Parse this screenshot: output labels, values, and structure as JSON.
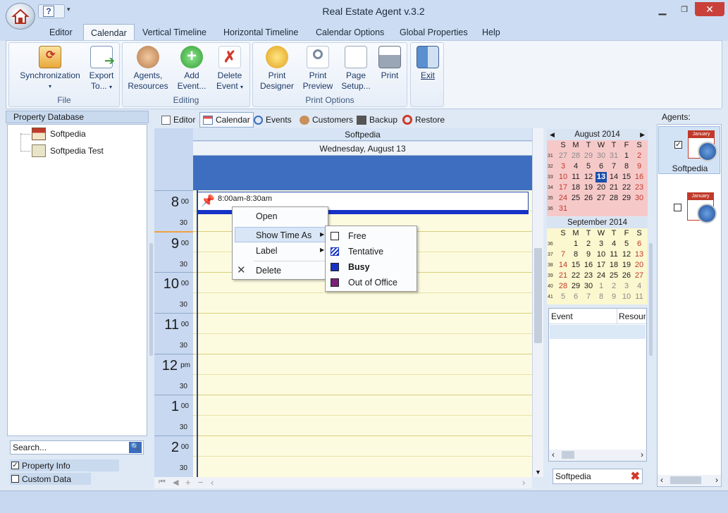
{
  "window": {
    "title": "Real Estate Agent v.3.2"
  },
  "tabs": [
    "Editor",
    "Calendar",
    "Vertical Timeline",
    "Horizontal Timeline",
    "Calendar Options",
    "Global Properties",
    "Help"
  ],
  "active_tab": "Calendar",
  "ribbon": {
    "groups": {
      "file": "File",
      "editing": "Editing",
      "print": "Print Options"
    },
    "buttons": {
      "sync_1": "Synchronization",
      "export_1": "Export",
      "export_2": "To...",
      "agents_1": "Agents,",
      "agents_2": "Resources",
      "add_1": "Add",
      "add_2": "Event...",
      "delete_1": "Delete",
      "delete_2": "Event",
      "pdesigner_1": "Print",
      "pdesigner_2": "Designer",
      "ppreview_1": "Print",
      "ppreview_2": "Preview",
      "psetup_1": "Page",
      "psetup_2": "Setup...",
      "print": "Print",
      "exit": "Exit"
    }
  },
  "left_panel": {
    "title": "Property Database",
    "items": [
      "Softpedia",
      "Softpedia Test"
    ],
    "search_placeholder": "Search...",
    "checks": [
      {
        "label": "Property Info",
        "checked": true
      },
      {
        "label": "Custom Data",
        "checked": false
      }
    ]
  },
  "view_tabs": [
    "Editor",
    "Calendar",
    "Events",
    "Customers",
    "Backup",
    "Restore"
  ],
  "day_view": {
    "resource": "Softpedia",
    "date": "Wednesday, August 13",
    "hours": [
      {
        "h": "8",
        "s": "00"
      },
      {
        "h": "9",
        "s": "00"
      },
      {
        "h": "10",
        "s": "00"
      },
      {
        "h": "11",
        "s": "00"
      },
      {
        "h": "12",
        "s": "pm"
      },
      {
        "h": "1",
        "s": "00"
      },
      {
        "h": "2",
        "s": "00"
      }
    ],
    "half": "30",
    "appointment": "8:00am-8:30am"
  },
  "context_menu": {
    "items": [
      "Open",
      "Show Time As",
      "Label",
      "Delete"
    ],
    "submenu": [
      "Free",
      "Tentative",
      "Busy",
      "Out of Office"
    ]
  },
  "mini_calendars": {
    "day_headers": [
      "S",
      "M",
      "T",
      "W",
      "T",
      "F",
      "S"
    ],
    "august": {
      "title": "August 2014",
      "weeks": [
        {
          "wk": "31",
          "days": [
            "27",
            "28",
            "29",
            "30",
            "31",
            "1",
            "2"
          ]
        },
        {
          "wk": "32",
          "days": [
            "3",
            "4",
            "5",
            "6",
            "7",
            "8",
            "9"
          ]
        },
        {
          "wk": "33",
          "days": [
            "10",
            "11",
            "12",
            "13",
            "14",
            "15",
            "16"
          ]
        },
        {
          "wk": "34",
          "days": [
            "17",
            "18",
            "19",
            "20",
            "21",
            "22",
            "23"
          ]
        },
        {
          "wk": "35",
          "days": [
            "24",
            "25",
            "26",
            "27",
            "28",
            "29",
            "30"
          ]
        },
        {
          "wk": "36",
          "days": [
            "31",
            "",
            "",
            "",
            "",
            "",
            ""
          ]
        }
      ],
      "selected": "13"
    },
    "september": {
      "title": "September 2014",
      "weeks": [
        {
          "wk": "36",
          "days": [
            "",
            "1",
            "2",
            "3",
            "4",
            "5",
            "6"
          ]
        },
        {
          "wk": "37",
          "days": [
            "7",
            "8",
            "9",
            "10",
            "11",
            "12",
            "13"
          ]
        },
        {
          "wk": "38",
          "days": [
            "14",
            "15",
            "16",
            "17",
            "18",
            "19",
            "20"
          ]
        },
        {
          "wk": "39",
          "days": [
            "21",
            "22",
            "23",
            "24",
            "25",
            "26",
            "27"
          ]
        },
        {
          "wk": "40",
          "days": [
            "28",
            "29",
            "30",
            "1",
            "2",
            "3",
            "4"
          ]
        },
        {
          "wk": "41",
          "days": [
            "5",
            "6",
            "7",
            "8",
            "9",
            "10",
            "11"
          ]
        }
      ]
    }
  },
  "event_list": {
    "columns": [
      "Event",
      "Resource"
    ]
  },
  "agent_filter": "Softpedia",
  "agents_panel": {
    "title": "Agents:",
    "agents": [
      {
        "name": "Softpedia",
        "checked": true,
        "icon_label": "January"
      },
      {
        "name": "",
        "checked": false,
        "icon_label": "January"
      }
    ]
  },
  "colors": {
    "accent": "#3d6ec0",
    "busy": "#1533c7",
    "ooo": "#7a1f7a",
    "weekend": "#c0392b"
  }
}
